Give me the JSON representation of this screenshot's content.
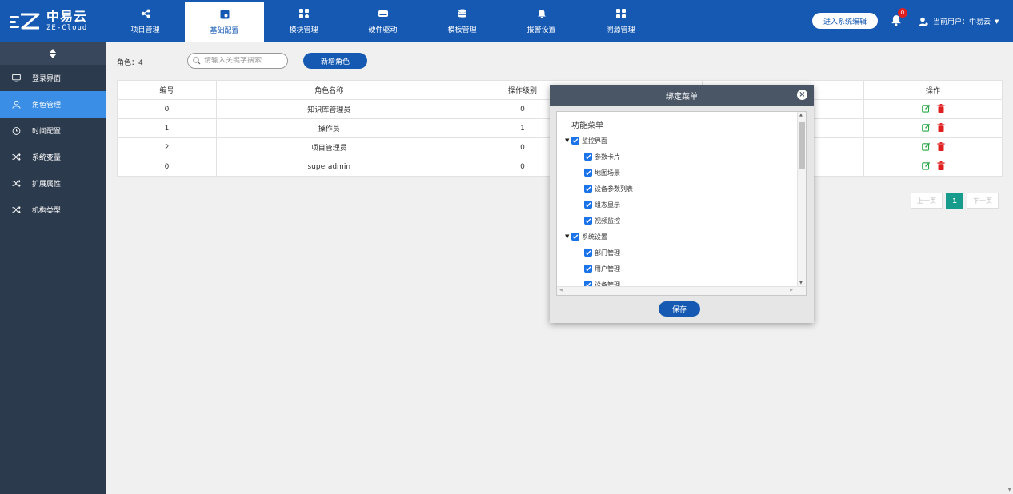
{
  "brand": {
    "name_cn": "中易云",
    "name_en": "ZE-Cloud"
  },
  "nav": {
    "tabs": [
      {
        "label": "项目管理",
        "icon": "share-icon"
      },
      {
        "label": "基础配置",
        "icon": "config-icon",
        "active": true
      },
      {
        "label": "模块管理",
        "icon": "modules-icon"
      },
      {
        "label": "硬件驱动",
        "icon": "drive-icon"
      },
      {
        "label": "模板管理",
        "icon": "database-icon"
      },
      {
        "label": "报警设置",
        "icon": "bell-icon"
      },
      {
        "label": "溯源管理",
        "icon": "grid-icon"
      }
    ]
  },
  "header": {
    "enter_label": "进入系统编辑",
    "notif_count": "0",
    "user_label": "当前用户：中易云"
  },
  "sidebar": {
    "items": [
      {
        "label": "登录界面",
        "icon": "monitor-icon"
      },
      {
        "label": "角色管理",
        "icon": "user-icon",
        "active": true
      },
      {
        "label": "时间配置",
        "icon": "clock-icon"
      },
      {
        "label": "系统变量",
        "icon": "shuffle-icon"
      },
      {
        "label": "扩展属性",
        "icon": "shuffle-icon"
      },
      {
        "label": "机构类型",
        "icon": "shuffle-icon"
      }
    ]
  },
  "toolbar": {
    "count_label": "角色：4",
    "search_placeholder": "请输入关键字搜索",
    "add_label": "新增角色"
  },
  "table": {
    "headers": [
      "编号",
      "角色名称",
      "操作级别",
      "",
      "",
      "操作"
    ],
    "rows": [
      [
        "0",
        "知识库管理员",
        "0"
      ],
      [
        "1",
        "操作员",
        "1"
      ],
      [
        "2",
        "项目管理员",
        "0"
      ],
      [
        "0",
        "superadmin",
        "0"
      ]
    ]
  },
  "pager": {
    "prev": "上一页",
    "current": "1",
    "next": "下一页"
  },
  "modal": {
    "title": "绑定菜单",
    "tree_title": "功能菜单",
    "groups": [
      {
        "label": "监控界面",
        "children": [
          "参数卡片",
          "地图场景",
          "设备参数列表",
          "组态显示",
          "视频监控"
        ]
      },
      {
        "label": "系统设置",
        "children": [
          "部门管理",
          "用户管理",
          "设备管理"
        ]
      }
    ],
    "save_label": "保存"
  },
  "colors": {
    "primary": "#1559b3",
    "sidebar": "#2c3a4d",
    "sidebar_active": "#3a8ee6",
    "edit": "#28a745",
    "delete": "#e02020",
    "pager_active": "#169b8c"
  }
}
